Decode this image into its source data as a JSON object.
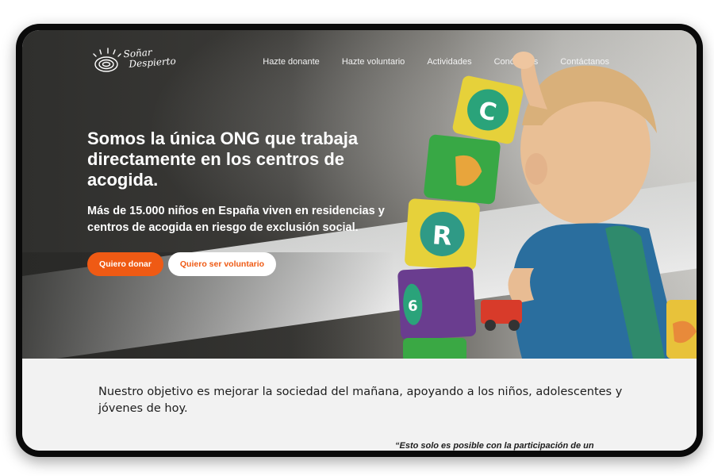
{
  "brand": {
    "name_line1": "Soñar",
    "name_line2": "Despierto"
  },
  "nav": {
    "items": [
      "Hazte donante",
      "Hazte voluntario",
      "Actividades",
      "Conócenos",
      "Contáctanos"
    ]
  },
  "hero": {
    "headline": "Somos la única ONG que trabaja directamente en los centros de acogida.",
    "subline": "Más de 15.000 niños en España viven en residencias y centros de acogida en riesgo de exclusión social.",
    "donate_label": "Quiero donar",
    "volunteer_label": "Quiero ser voluntario"
  },
  "content": {
    "objective": "Nuestro objetivo es mejorar la sociedad del mañana, apoyando a los niños, adolescentes y jóvenes de hoy.",
    "quote": "“Esto solo es posible con la participación de un"
  },
  "colors": {
    "accent": "#ef5a14",
    "text_dark": "#1d1d1d",
    "page_bg": "#f2f2f2"
  },
  "blocks": [
    "C",
    "R",
    "6"
  ]
}
